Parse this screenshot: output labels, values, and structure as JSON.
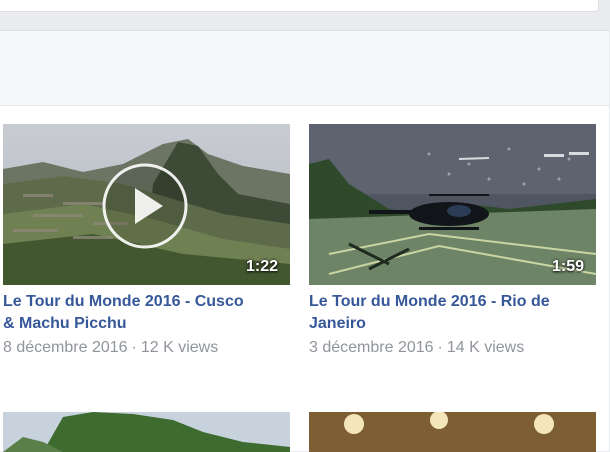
{
  "videos": [
    {
      "title_line1": "Le Tour du Monde 2016 - Cusco",
      "title_line2": "& Machu Picchu",
      "duration": "1:22",
      "date": "8 décembre 2016",
      "separator": "·",
      "views": "12 K views",
      "thumbnail_scene": "mountain-ruins",
      "show_play_overlay": true
    },
    {
      "title_line1": "Le Tour du Monde 2016 - Rio de",
      "title_line2": "Janeiro",
      "duration": "1:59",
      "date": "3 décembre 2016",
      "separator": "·",
      "views": "14 K views",
      "thumbnail_scene": "helicopter-helipad",
      "show_play_overlay": false
    }
  ],
  "colors": {
    "page_bg": "#e9ebee",
    "link": "#365899",
    "meta": "#90949c",
    "panel_header": "#f6f7f9"
  }
}
